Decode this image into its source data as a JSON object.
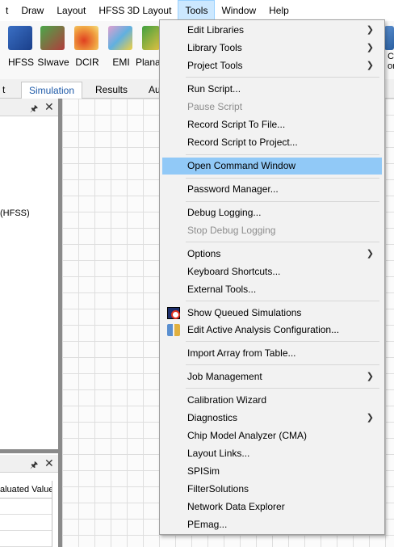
{
  "menubar": {
    "items": [
      "t",
      "Draw",
      "Layout",
      "HFSS 3D Layout",
      "Tools",
      "Window",
      "Help"
    ]
  },
  "ribbon": {
    "buttons": [
      "HFSS",
      "SIwave",
      "DCIR",
      "EMI",
      "Plana",
      "C",
      "on"
    ]
  },
  "tabs": [
    "t",
    "Simulation",
    "Results",
    "Au"
  ],
  "left_panel": {
    "partial_text": "(HFSS)",
    "table_header": "aluated Value"
  },
  "tools_menu": {
    "items": [
      {
        "label": "Edit Libraries",
        "submenu": true
      },
      {
        "label": "Library Tools",
        "submenu": true
      },
      {
        "label": "Project Tools",
        "submenu": true
      },
      {
        "label": "Run Script..."
      },
      {
        "label": "Pause Script",
        "disabled": true
      },
      {
        "label": "Record Script To File..."
      },
      {
        "label": "Record Script to Project..."
      },
      {
        "label": "Open Command Window",
        "highlighted": true
      },
      {
        "label": "Password Manager..."
      },
      {
        "label": "Debug Logging..."
      },
      {
        "label": "Stop Debug Logging",
        "disabled": true
      },
      {
        "label": "Options",
        "submenu": true
      },
      {
        "label": "Keyboard Shortcuts..."
      },
      {
        "label": "External Tools..."
      },
      {
        "label": "Show Queued Simulations",
        "icon": "queued-simulations-icon"
      },
      {
        "label": "Edit Active Analysis Configuration...",
        "icon": "analysis-config-icon"
      },
      {
        "label": "Import Array from Table..."
      },
      {
        "label": "Job Management",
        "submenu": true
      },
      {
        "label": "Calibration Wizard"
      },
      {
        "label": "Diagnostics",
        "submenu": true
      },
      {
        "label": "Chip Model Analyzer (CMA)"
      },
      {
        "label": "Layout Links..."
      },
      {
        "label": "SPISim"
      },
      {
        "label": "FilterSolutions"
      },
      {
        "label": "Network Data Explorer"
      },
      {
        "label": "PEmag..."
      }
    ]
  },
  "colors": {
    "highlight": "#91c9f7",
    "menubar_open": "#cce8ff",
    "active_tab_text": "#1e5aa8"
  }
}
